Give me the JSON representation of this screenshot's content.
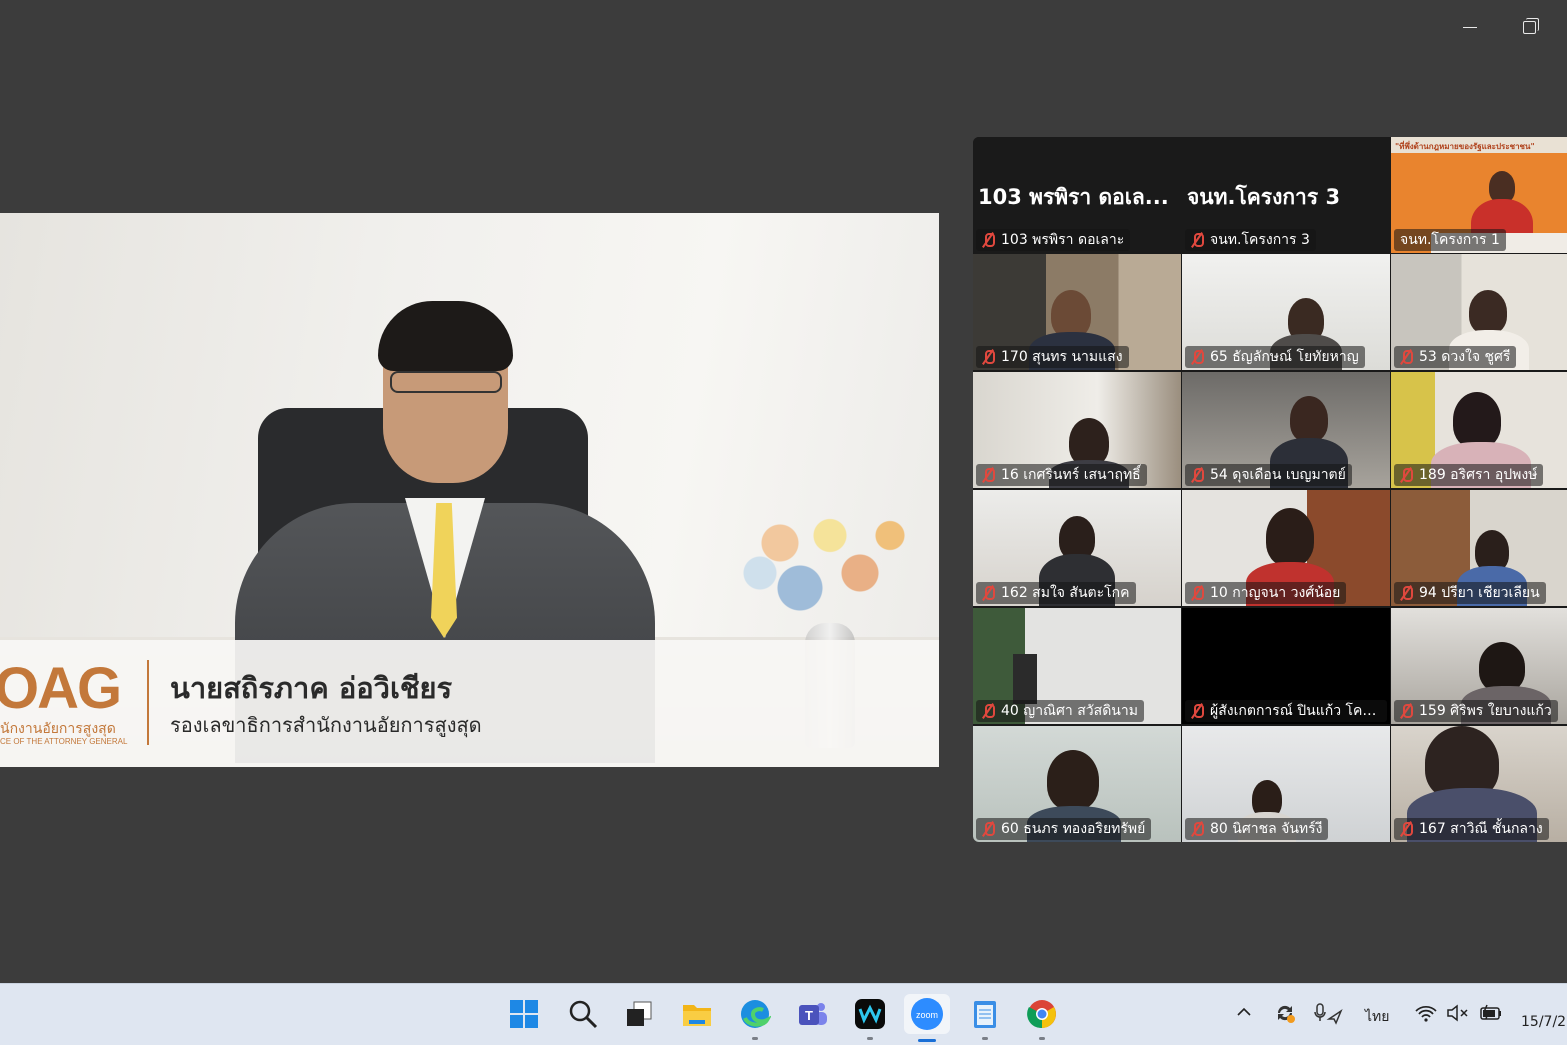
{
  "window": {
    "minimize_icon": "minimize-icon",
    "restore_icon": "restore-icon"
  },
  "speaker": {
    "logo_mark": "OAG",
    "logo_line1": "นักงานอัยการสูงสุด",
    "logo_line2": "CE OF THE ATTORNEY GENERAL",
    "name": "นายสถิรภาค อ่อวิเชียร",
    "title": "รองเลขาธิการสำนักงานอัยการสูงสุด"
  },
  "gallery": {
    "tiles": [
      {
        "big": "103 พรพิรา ดอเล...",
        "label": "103 พรพิรา ดอเลาะ"
      },
      {
        "big": "จนท.โครงการ 3",
        "label": "จนท.โครงการ 3"
      },
      {
        "label": "จนท.โครงการ 1",
        "banner": "\"ที่พึ่งด้านกฎหมายของรัฐและประชาชน\""
      },
      {
        "label": "170 สุนทร นามแสง"
      },
      {
        "label": "65 ธัญลักษณ์ โยทัยหาญ"
      },
      {
        "label": "53 ดวงใจ ชูศรี"
      },
      {
        "label": "16 เกศรินทร์ เสนาฤทธิ์"
      },
      {
        "label": "54 ดุจเดือน เบญมาตย์"
      },
      {
        "label": "189 อริศรา อุปพงษ์"
      },
      {
        "label": "162 สมใจ สันตะโกค"
      },
      {
        "label": "10 กาญจนา วงศ์น้อย"
      },
      {
        "label": "94 ปรียา เชียวเลียน"
      },
      {
        "label": "40 ญาณิศา สวัสดินาม"
      },
      {
        "label": "ผู้สังเกตการณ์ ปินแก้ว โคต..."
      },
      {
        "label": "159 ศิริพร ใยบางแก้ว"
      },
      {
        "label": "60 ธนภร ทองอริยทรัพย์"
      },
      {
        "label": "80 นิศาชล จันทร์งี"
      },
      {
        "label": "167 สาวิณี ชั้นกลาง"
      }
    ]
  },
  "taskbar": {
    "apps": [
      "windows-start-icon",
      "search-icon",
      "task-view-icon",
      "file-explorer-icon",
      "edge-icon",
      "teams-icon",
      "webex-icon",
      "zoom-icon",
      "notepad-icon",
      "chrome-icon"
    ],
    "zoom_label": "zoom",
    "language": "ไทย",
    "clock": "15/7/2"
  }
}
